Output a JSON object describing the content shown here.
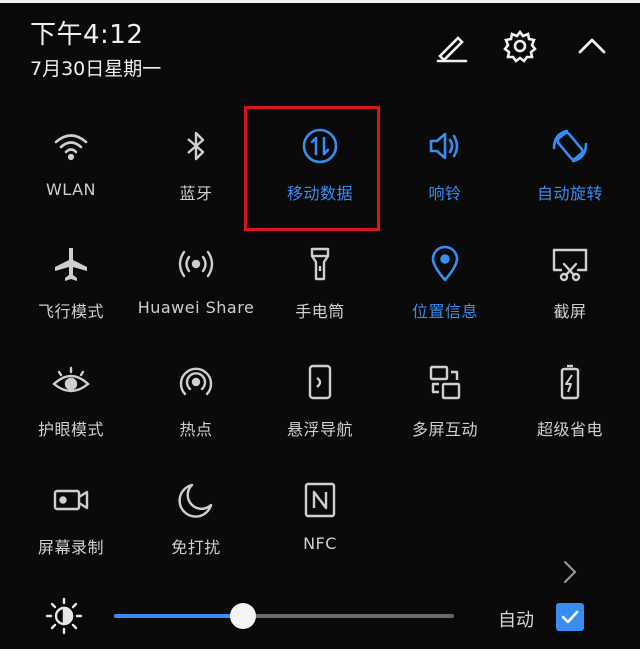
{
  "status": {
    "time": "下午4:12",
    "date": "7月30日星期一"
  },
  "header_icons": [
    "edit-icon",
    "settings-icon",
    "collapse-chevron-icon"
  ],
  "colors": {
    "background": "#0a0a0a",
    "accent": "#3b8cf0",
    "highlight_box": "#d8171d",
    "text": "#cfcfcf"
  },
  "tiles": [
    {
      "label": "WLAN",
      "icon": "wifi-icon",
      "active": false
    },
    {
      "label": "蓝牙",
      "icon": "bluetooth-icon",
      "active": false
    },
    {
      "label": "移动数据",
      "icon": "mobile-data-icon",
      "active": true
    },
    {
      "label": "响铃",
      "icon": "speaker-icon",
      "active": true
    },
    {
      "label": "自动旋转",
      "icon": "auto-rotate-icon",
      "active": true
    },
    {
      "label": "飞行模式",
      "icon": "airplane-icon",
      "active": false
    },
    {
      "label": "Huawei Share",
      "icon": "huawei-share-icon",
      "active": false
    },
    {
      "label": "手电筒",
      "icon": "flashlight-icon",
      "active": false
    },
    {
      "label": "位置信息",
      "icon": "location-icon",
      "active": true
    },
    {
      "label": "截屏",
      "icon": "screenshot-icon",
      "active": false
    },
    {
      "label": "护眼模式",
      "icon": "eye-icon",
      "active": false
    },
    {
      "label": "热点",
      "icon": "hotspot-icon",
      "active": false
    },
    {
      "label": "悬浮导航",
      "icon": "floating-nav-icon",
      "active": false
    },
    {
      "label": "多屏互动",
      "icon": "multi-screen-icon",
      "active": false
    },
    {
      "label": "超级省电",
      "icon": "battery-saver-icon",
      "active": false
    },
    {
      "label": "屏幕录制",
      "icon": "screen-record-icon",
      "active": false
    },
    {
      "label": "免打扰",
      "icon": "do-not-disturb-icon",
      "active": false
    },
    {
      "label": "NFC",
      "icon": "nfc-icon",
      "active": false
    }
  ],
  "brightness": {
    "level": 0.38,
    "auto_label": "自动",
    "auto_checked": true
  }
}
